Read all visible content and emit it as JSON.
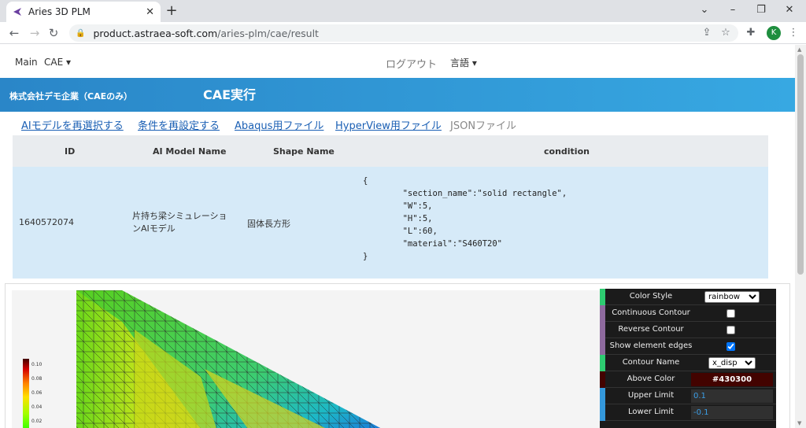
{
  "browser": {
    "tab_title": "Aries 3D PLM",
    "tab_close": "✕",
    "new_tab": "+",
    "url_host": "product.astraea-soft.com",
    "url_path": "/aries-plm/cae/result",
    "profile_initial": "K"
  },
  "nav": {
    "main": "Main",
    "cae": "CAE ▾",
    "logout": "ログアウト",
    "language": "言語 ▾"
  },
  "banner": {
    "company": "株式会社デモ企業（CAEのみ）",
    "title": "CAE実行"
  },
  "links": {
    "reselect_model": "AIモデルを再選択する",
    "reset_conditions": "条件を再設定する",
    "abaqus": "Abaqus用ファイル",
    "hyperview": "HyperView用ファイル",
    "json": "JSONファイル"
  },
  "table": {
    "headers": [
      "ID",
      "AI Model Name",
      "Shape Name",
      "condition"
    ],
    "row": {
      "id": "1640572074",
      "model_name": "片持ち梁シミュレーションAIモデル",
      "shape_name": "固体長方形",
      "condition": "{\n        \"section_name\":\"solid rectangle\",\n        \"W\":5,\n        \"H\":5,\n        \"L\":60,\n        \"material\":\"S460T20\"\n}"
    }
  },
  "legend": {
    "ticks": [
      "0.10",
      "0.08",
      "0.06",
      "0.04",
      "0.02"
    ]
  },
  "panel": {
    "color_style_label": "Color Style",
    "color_style_value": "rainbow",
    "continuous_label": "Continuous Contour",
    "reverse_label": "Reverse Contour",
    "edges_label": "Show element edges",
    "contour_name_label": "Contour Name",
    "contour_name_value": "x_disp",
    "above_color_label": "Above Color",
    "above_color_value": "#430300",
    "upper_limit_label": "Upper Limit",
    "upper_limit_value": "0.1",
    "lower_limit_label": "Lower Limit",
    "lower_limit_value": "-0.1"
  }
}
